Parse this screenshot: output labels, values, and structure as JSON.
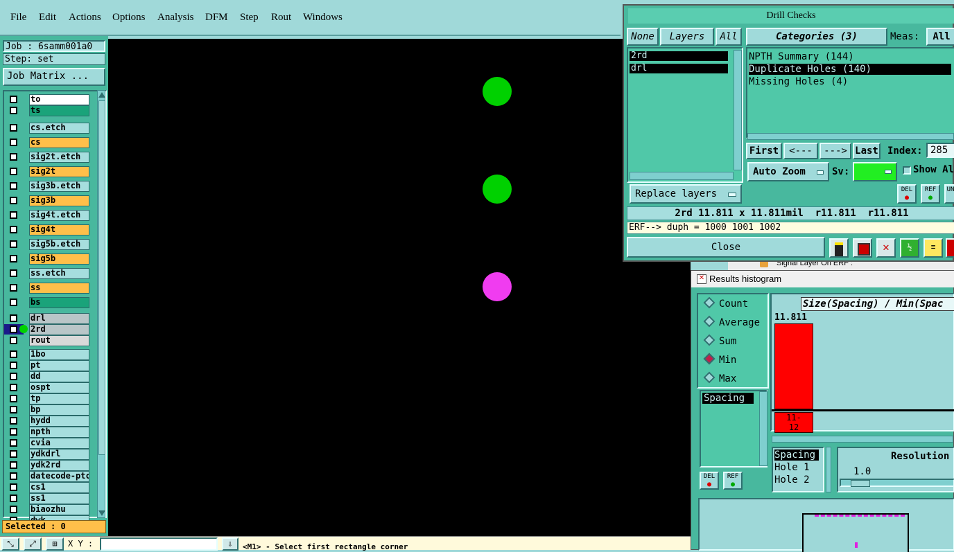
{
  "menu": [
    "File",
    "Edit",
    "Actions",
    "Options",
    "Analysis",
    "DFM",
    "Step",
    "Rout",
    "Windows"
  ],
  "job": {
    "job_label": "Job : 6samm001a0",
    "step_label": "Step: set",
    "matrix_button": "Job Matrix ..."
  },
  "layers": [
    {
      "name": "to",
      "color": "#ffffff"
    },
    {
      "name": "ts",
      "color": "#1aa37a"
    },
    {
      "name": "cs.etch",
      "color": "#a6dede"
    },
    {
      "name": "cs",
      "color": "#ffbf4a"
    },
    {
      "name": "sig2t.etch",
      "color": "#a6dede"
    },
    {
      "name": "sig2t",
      "color": "#ffbf4a"
    },
    {
      "name": "sig3b.etch",
      "color": "#a6dede"
    },
    {
      "name": "sig3b",
      "color": "#ffbf4a"
    },
    {
      "name": "sig4t.etch",
      "color": "#a6dede"
    },
    {
      "name": "sig4t",
      "color": "#ffbf4a"
    },
    {
      "name": "sig5b.etch",
      "color": "#a6dede"
    },
    {
      "name": "sig5b",
      "color": "#ffbf4a"
    },
    {
      "name": "ss.etch",
      "color": "#a6dede"
    },
    {
      "name": "ss",
      "color": "#ffbf4a"
    },
    {
      "name": "bs",
      "color": "#1aa37a"
    },
    {
      "name": "drl",
      "color": "#b9c6c8"
    },
    {
      "name": "2rd",
      "color": "#b9c6c8"
    },
    {
      "name": "rout",
      "color": "#d9d9d9"
    },
    {
      "name": "1bo",
      "color": "#a6dede"
    },
    {
      "name": "pt",
      "color": "#a6dede"
    },
    {
      "name": "dd",
      "color": "#a6dede"
    },
    {
      "name": "ospt",
      "color": "#a6dede"
    },
    {
      "name": "tp",
      "color": "#a6dede"
    },
    {
      "name": "bp",
      "color": "#a6dede"
    },
    {
      "name": "hydd",
      "color": "#a6dede"
    },
    {
      "name": "npth",
      "color": "#a6dede"
    },
    {
      "name": "cvia",
      "color": "#a6dede"
    },
    {
      "name": "ydkdrl",
      "color": "#a6dede"
    },
    {
      "name": "ydk2rd",
      "color": "#a6dede"
    },
    {
      "name": "datecode-ptc",
      "color": "#a6dede"
    },
    {
      "name": "cs1",
      "color": "#a6dede"
    },
    {
      "name": "ss1",
      "color": "#a6dede"
    },
    {
      "name": "biaozhu",
      "color": "#a6dede"
    },
    {
      "name": "dwk",
      "color": "#a6dede"
    }
  ],
  "selected_label": "Selected : 0",
  "status": {
    "xy_label": "X Y :",
    "prompt": "<M1> - Select first rectangle corner"
  },
  "drill": {
    "title": "Drill Checks",
    "none_btn": "None",
    "layers_btn": "Layers",
    "all_btn": "All",
    "layer_items": [
      "2rd",
      "drl"
    ],
    "categories_label": "Categories (3)",
    "meas_label": "Meas:",
    "meas_value": "All",
    "categories": [
      "NPTH Summary (144)",
      "Duplicate Holes (140)",
      "Missing Holes (4)"
    ],
    "nav": [
      "First",
      "<---",
      "--->",
      "Last"
    ],
    "index_label": "Index:",
    "index_value": "285",
    "autozoom": "Auto Zoom",
    "sv_label": "Sv:",
    "show_all": "Show Al",
    "replace_layers": "Replace layers",
    "info": "2rd 11.811 x 11.811mil  r11.811  r11.811",
    "erf": "ERF--> duph = 1000 1001 1002",
    "close": "Close",
    "del": "DEL",
    "ref": "REF",
    "un": "UN"
  },
  "bg_window": {
    "title": "Signal Layer On ERF :"
  },
  "hist": {
    "title": "Results histogram",
    "radios": [
      "Count",
      "Average",
      "Sum",
      "Min",
      "Max"
    ],
    "selected_radio": "Min",
    "attr_list": [
      "Spacing"
    ],
    "del": "DEL",
    "ref": "REF",
    "chart_title": "Size(Spacing) / Min(Spac",
    "bar_value": "11.811",
    "bar_label": "11-\n12",
    "sort_list": [
      "Spacing",
      "Hole 1",
      "Hole 2"
    ],
    "resolution_label": "Resolution",
    "resolution_value": "1.0"
  }
}
